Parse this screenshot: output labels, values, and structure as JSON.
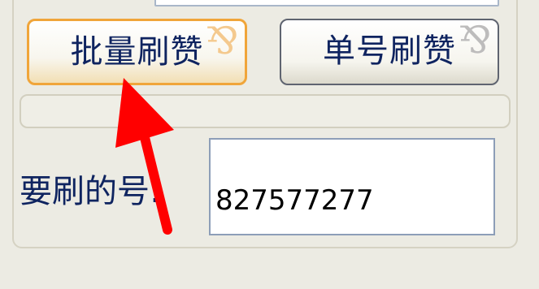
{
  "buttons": {
    "batch_label": "批量刷赞",
    "single_label": "单号刷赞",
    "deco_glyph": "⅋"
  },
  "target": {
    "label": "要刷的号:",
    "value": "827577277"
  },
  "colors": {
    "accent_border": "#f0a53a",
    "text": "#0f2460",
    "arrow": "#ff0000"
  }
}
